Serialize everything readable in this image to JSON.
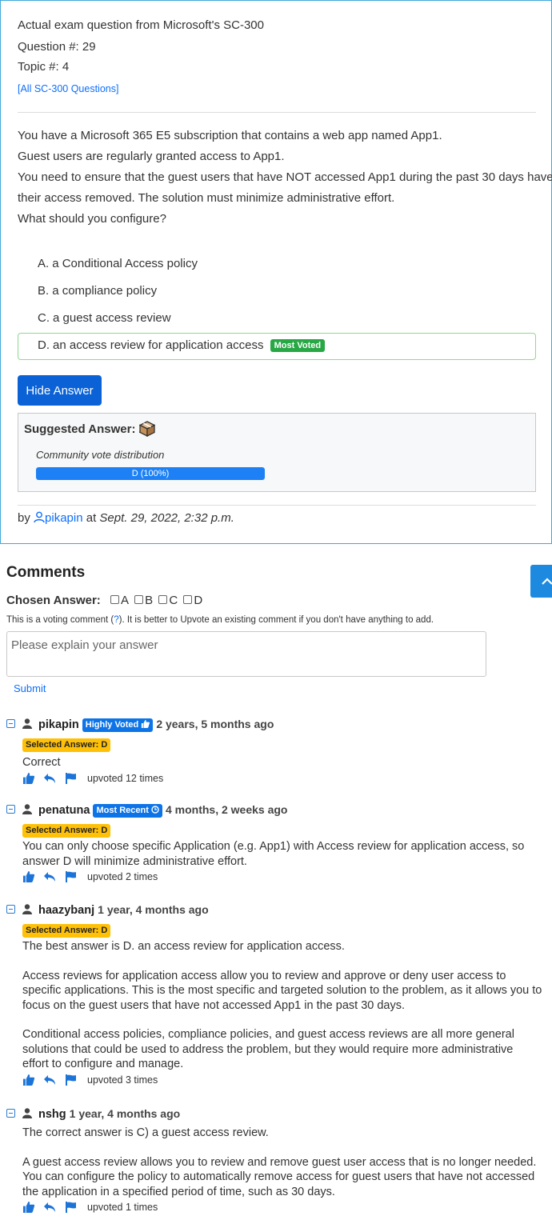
{
  "header": {
    "title": "Actual exam question from Microsoft's SC-300",
    "question_no": "Question #: 29",
    "topic_no": "Topic #: 4",
    "all_link": "[All SC-300 Questions]"
  },
  "question": {
    "lines": [
      "You have a Microsoft 365 E5 subscription that contains a web app named App1.",
      "Guest users are regularly granted access to App1.",
      "You need to ensure that the guest users that have NOT accessed App1 during the past 30 days have",
      "their access removed. The solution must minimize administrative effort.",
      "What should you configure?"
    ],
    "choices": [
      {
        "letter": "A.",
        "text": "a Conditional Access policy"
      },
      {
        "letter": "B.",
        "text": "a compliance policy"
      },
      {
        "letter": "C.",
        "text": "a guest access review"
      },
      {
        "letter": "D.",
        "text": "an access review for application access",
        "badge": "Most Voted"
      }
    ],
    "hide_answer_label": "Hide Answer",
    "suggested_label": "Suggested Answer:",
    "suggested_value": "D",
    "community_label": "Community vote distribution",
    "vote_bar_text": "D (100%)",
    "vote_fraction": 1.0,
    "by": "by",
    "author": "pikapin",
    "at": "at",
    "date": "Sept. 29, 2022, 2:32 p.m."
  },
  "comments_section": {
    "title": "Comments",
    "chosen_label": "Chosen Answer:",
    "options": [
      "A",
      "B",
      "C",
      "D"
    ],
    "note_pre": "This is a voting comment (",
    "note_q": "?",
    "note_post": "). It is better to Upvote an existing comment if you don't have anything to add.",
    "placeholder": "Please explain your answer",
    "submit": "Submit"
  },
  "comments": [
    {
      "user": "pikapin",
      "badge": "Highly Voted",
      "age": "2 years, 5 months ago",
      "selected": "Selected Answer: D",
      "paragraphs": [
        "Correct"
      ],
      "upvotes": "upvoted 12 times"
    },
    {
      "user": "penatuna",
      "badge": "Most Recent",
      "age": "4 months, 2 weeks ago",
      "selected": "Selected Answer: D",
      "paragraphs": [
        "You can only choose specific Application (e.g. App1) with Access review for application access, so answer D will minimize administrative effort."
      ],
      "upvotes": "upvoted 2 times"
    },
    {
      "user": "haazybanj",
      "age": "1 year, 4 months ago",
      "selected": "Selected Answer: D",
      "paragraphs": [
        "The best answer is D. an access review for application access.",
        "Access reviews for application access allow you to review and approve or deny user access to specific applications. This is the most specific and targeted solution to the problem, as it allows you to focus on the guest users that have not accessed App1 in the past 30 days.",
        "Conditional access policies, compliance policies, and guest access reviews are all more general solutions that could be used to address the problem, but they would require more administrative effort to configure and manage."
      ],
      "upvotes": "upvoted 3 times"
    },
    {
      "user": "nshg",
      "age": "1 year, 4 months ago",
      "paragraphs": [
        "The correct answer is C) a guest access review.",
        "A guest access review allows you to review and remove guest user access that is no longer needed. You can configure the policy to automatically remove access for guest users that have not accessed the application in a specified period of time, such as 30 days."
      ],
      "upvotes": "upvoted 1 times"
    }
  ]
}
